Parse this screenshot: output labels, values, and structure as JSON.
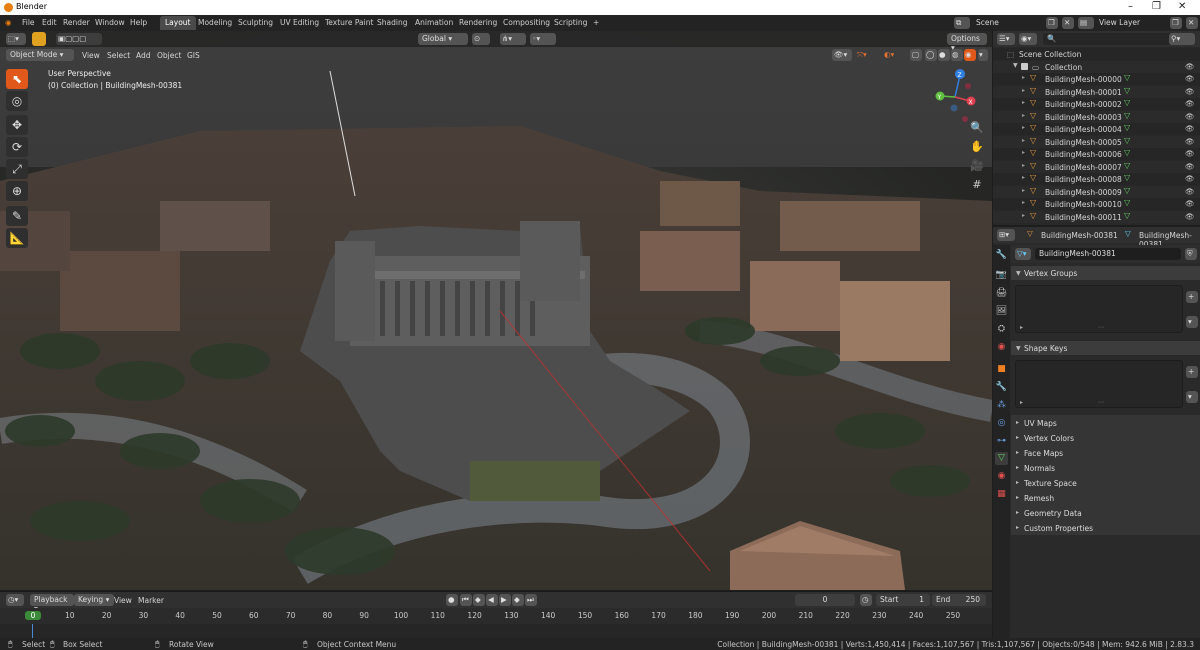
{
  "window": {
    "title": "Blender"
  },
  "menu": [
    "File",
    "Edit",
    "Render",
    "Window",
    "Help"
  ],
  "workspaces": [
    "Layout",
    "Modeling",
    "Sculpting",
    "UV Editing",
    "Texture Paint",
    "Shading",
    "Animation",
    "Rendering",
    "Compositing",
    "Scripting"
  ],
  "workspace_add": "+",
  "scene": {
    "name": "Scene",
    "view_layer": "View Layer"
  },
  "viewport": {
    "mode": "Object Mode",
    "menus": [
      "View",
      "Select",
      "Add",
      "Object",
      "GIS"
    ],
    "transform_orientation": "Global",
    "options_label": "Options",
    "perspective_label": "User Perspective",
    "collection_label": "(0) Collection | BuildingMesh-00381",
    "gizmo": {
      "x": "X",
      "y": "Y",
      "z": "Z"
    }
  },
  "outliner": {
    "root": "Scene Collection",
    "collection": "Collection",
    "items": [
      "BuildingMesh-00000",
      "BuildingMesh-00001",
      "BuildingMesh-00002",
      "BuildingMesh-00003",
      "BuildingMesh-00004",
      "BuildingMesh-00005",
      "BuildingMesh-00006",
      "BuildingMesh-00007",
      "BuildingMesh-00008",
      "BuildingMesh-00009",
      "BuildingMesh-00010",
      "BuildingMesh-00011"
    ]
  },
  "properties": {
    "header_object": "BuildingMesh-00381",
    "header_data": "BuildingMesh-00381",
    "mesh_name": "BuildingMesh-00381",
    "panels": {
      "vertex_groups": "Vertex Groups",
      "shape_keys": "Shape Keys"
    },
    "collapsed_panels": [
      "UV Maps",
      "Vertex Colors",
      "Face Maps",
      "Normals",
      "Texture Space",
      "Remesh",
      "Geometry Data",
      "Custom Properties"
    ]
  },
  "timeline": {
    "menus": [
      "Playback",
      "Keying",
      "View",
      "Marker"
    ],
    "current_frame": "0",
    "start_label": "Start",
    "start": "1",
    "end_label": "End",
    "end": "250",
    "ticks": [
      "0",
      "10",
      "20",
      "30",
      "40",
      "50",
      "60",
      "70",
      "80",
      "90",
      "100",
      "110",
      "120",
      "130",
      "140",
      "150",
      "160",
      "170",
      "180",
      "190",
      "200",
      "210",
      "220",
      "230",
      "240",
      "250"
    ]
  },
  "statusbar": {
    "select": "Select",
    "box_select": "Box Select",
    "rotate_view": "Rotate View",
    "context_menu": "Object Context Menu",
    "stats": "Collection | BuildingMesh-00381 | Verts:1,450,414 | Faces:1,107,567 | Tris:1,107,567 | Objects:0/548 | Mem: 942.6 MiB | 2.83.3"
  },
  "colors": {
    "accent_orange": "#e0581a",
    "active_tab": "#4a4a4a",
    "mesh_icon": "#e8a040",
    "axis_x": "#e04050",
    "axis_y": "#60c040",
    "axis_z": "#3080e0"
  }
}
